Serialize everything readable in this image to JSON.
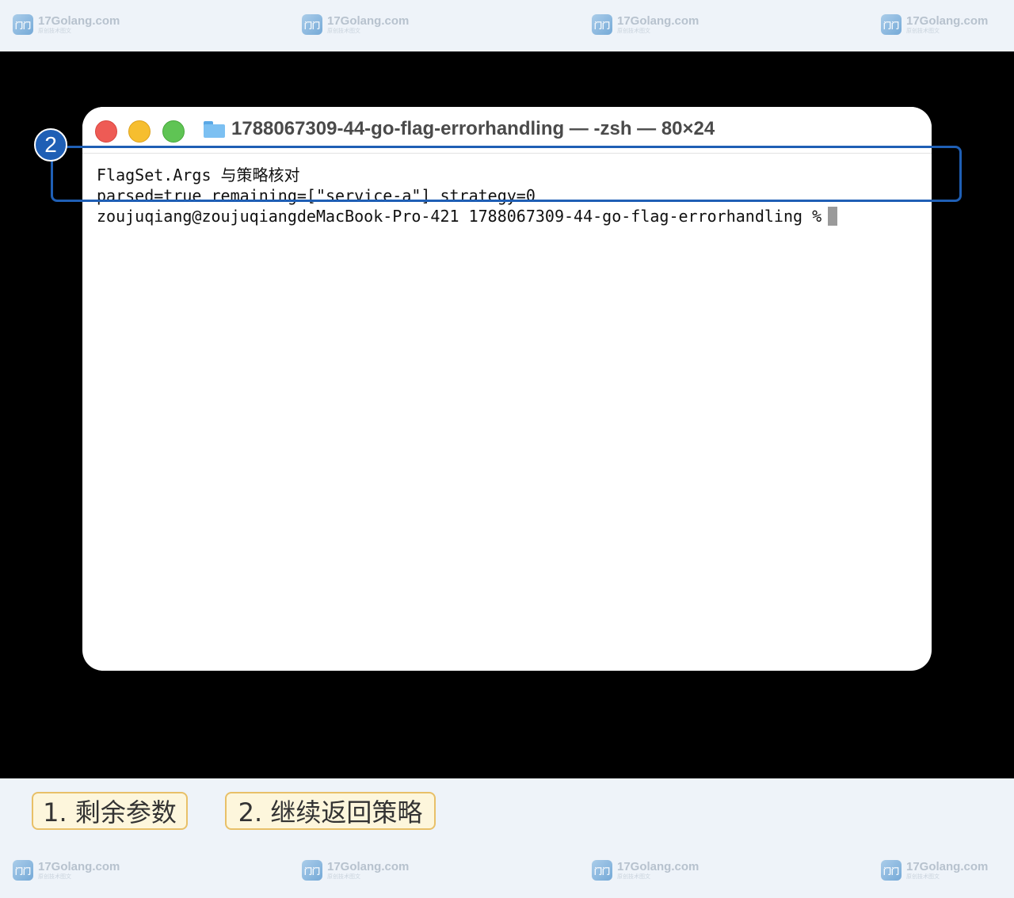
{
  "watermark": {
    "logo_text": "门门",
    "name": "17Golang.com",
    "tagline": "原创技术图文"
  },
  "terminal": {
    "title": "1788067309-44-go-flag-errorhandling — -zsh — 80×24",
    "lines": [
      "FlagSet.Args 与策略核对",
      "parsed=true remaining=[\"service-a\"] strategy=0",
      "zoujuqiang@zoujuqiangdeMacBook-Pro-421 1788067309-44-go-flag-errorhandling %"
    ]
  },
  "annotation": {
    "step_number": "2"
  },
  "labels": [
    "1. 剩余参数",
    "2. 继续返回策略"
  ],
  "colors": {
    "page_background": "#eef3f9",
    "stage_background": "#000000",
    "highlight": "#1f5fb5",
    "label_background": "#fdf6dc",
    "label_border": "#e8c068",
    "traffic_red": "#ee5b55",
    "traffic_yellow": "#f6be2f",
    "traffic_green": "#5fc454"
  }
}
